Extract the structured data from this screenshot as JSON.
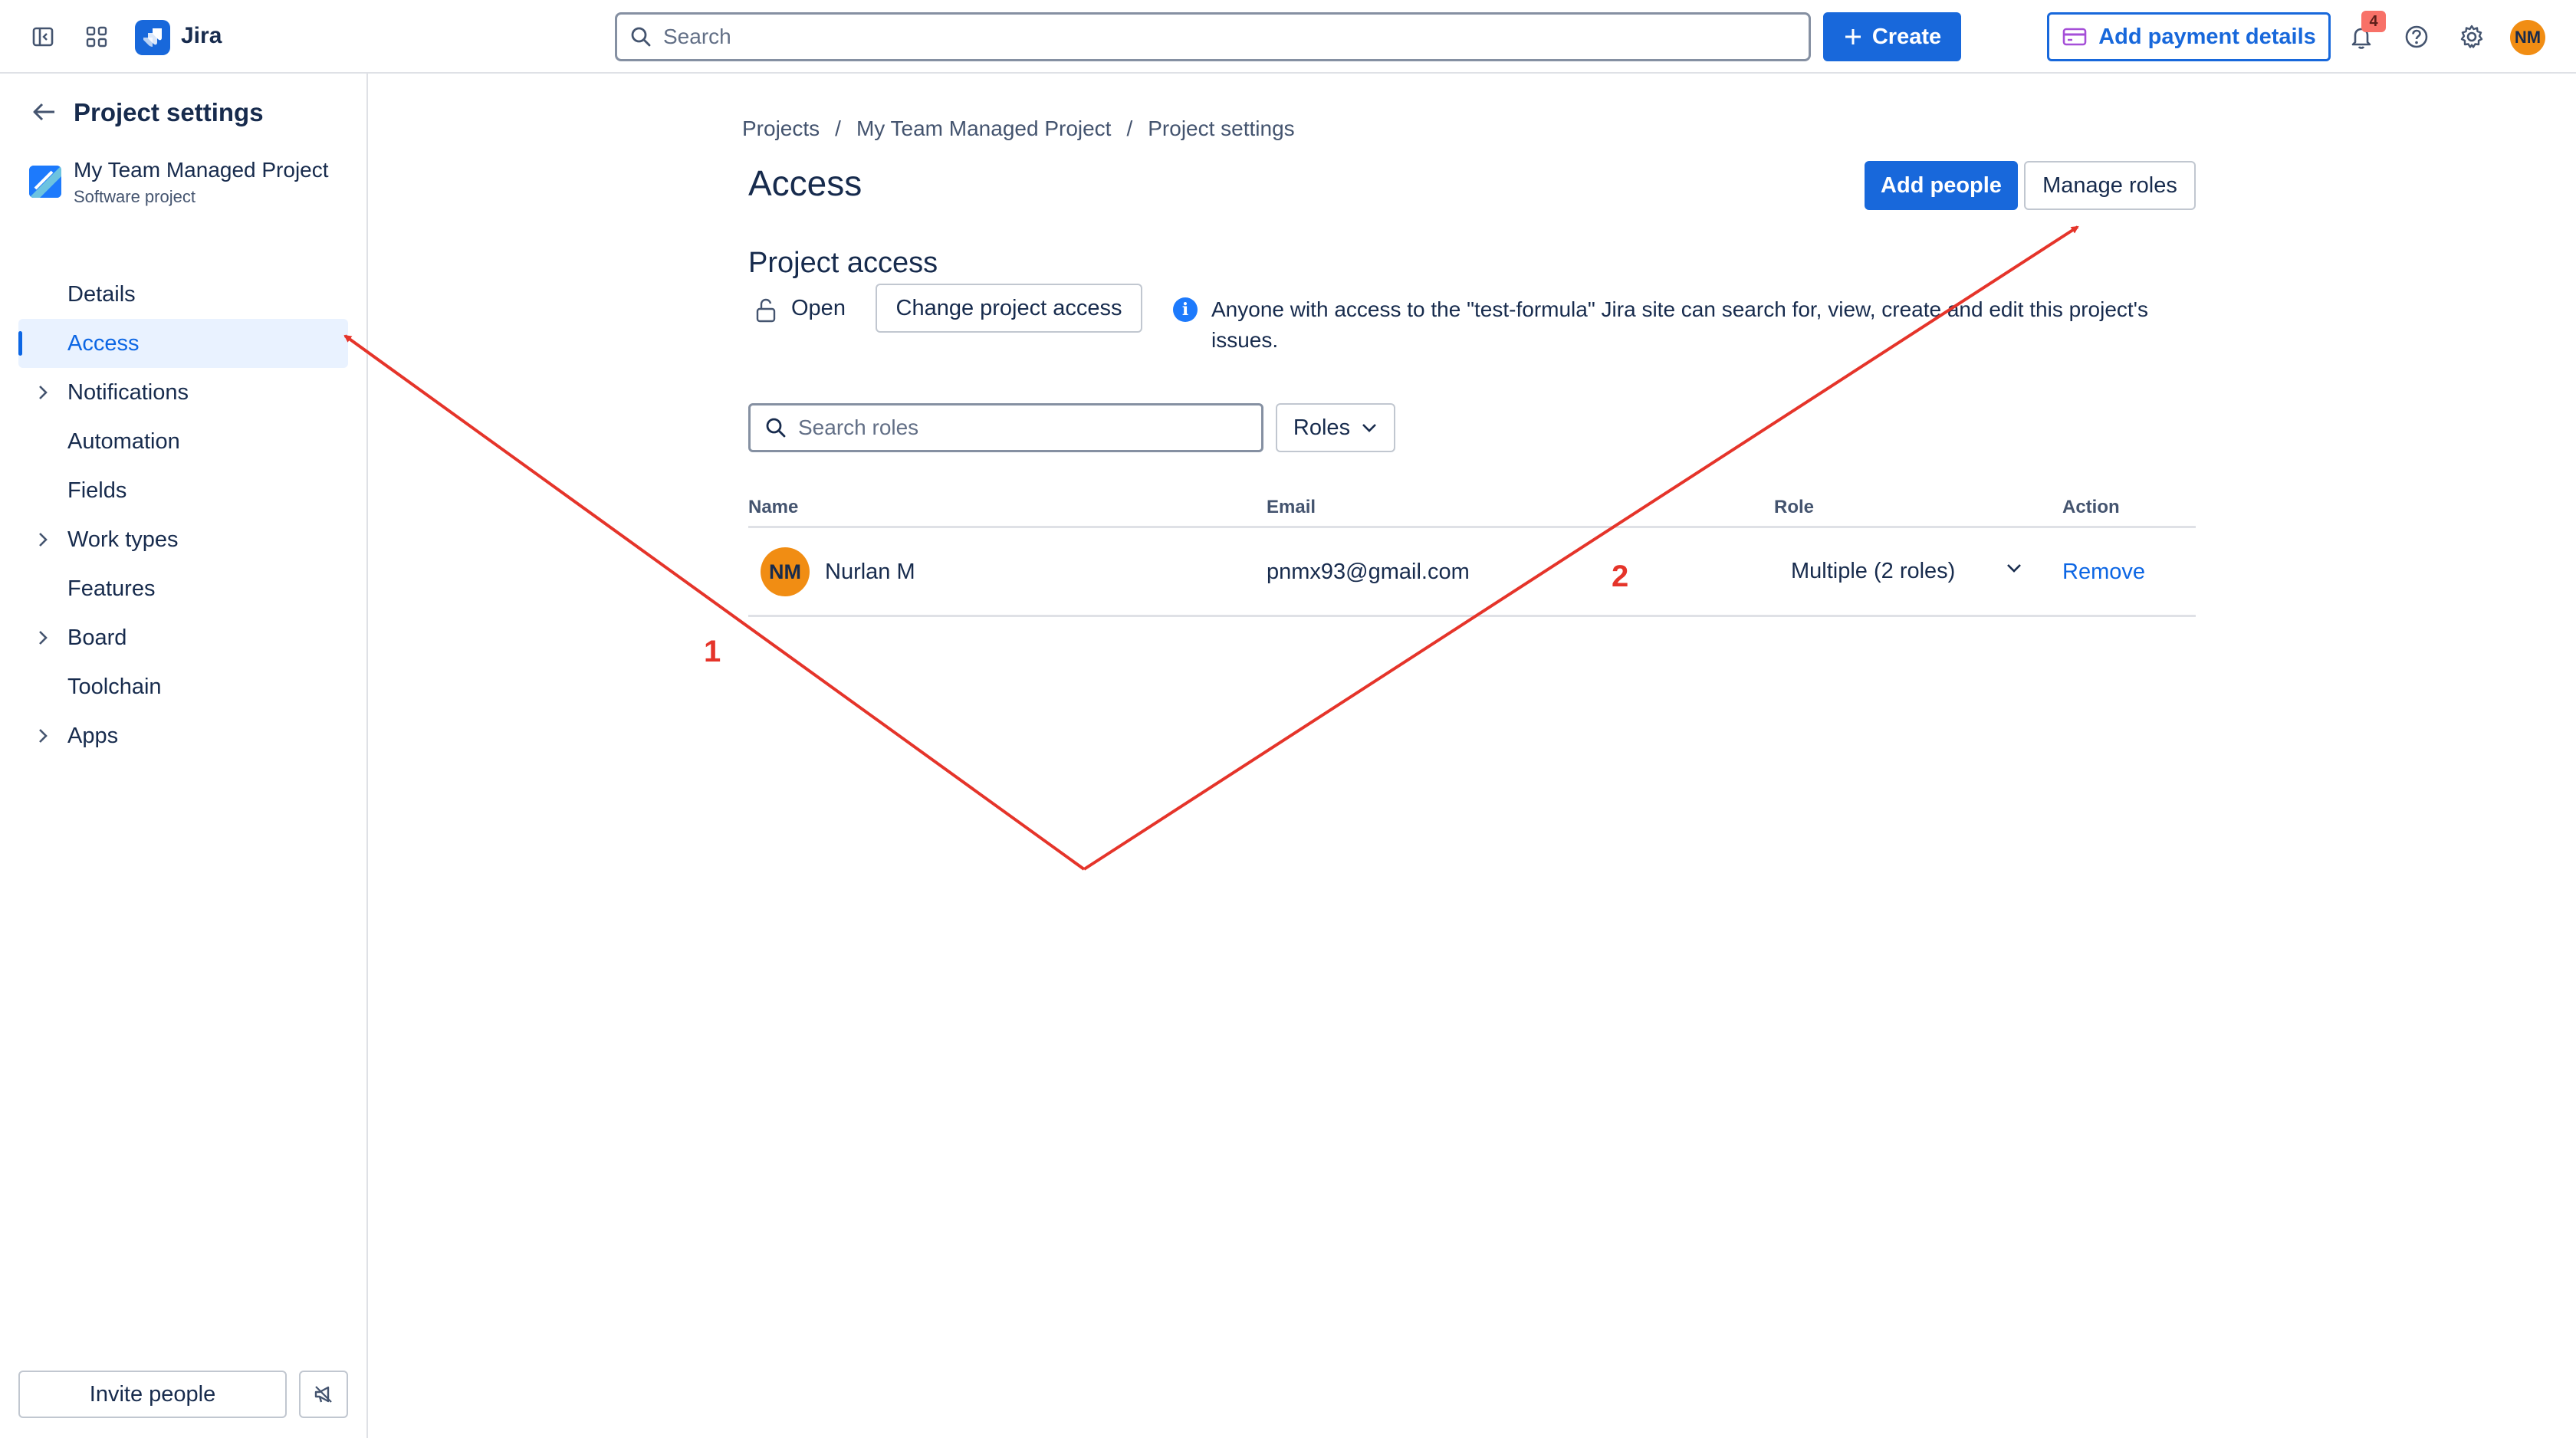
{
  "app": {
    "name": "Jira"
  },
  "topbar": {
    "search_placeholder": "Search",
    "create_label": "Create",
    "payment_label": "Add payment details",
    "notification_count": "4",
    "user_initials": "NM"
  },
  "sidebar": {
    "title": "Project settings",
    "project_name": "My Team Managed Project",
    "project_type": "Software project",
    "items": [
      {
        "label": "Details",
        "expandable": false,
        "active": false
      },
      {
        "label": "Access",
        "expandable": false,
        "active": true
      },
      {
        "label": "Notifications",
        "expandable": true,
        "active": false
      },
      {
        "label": "Automation",
        "expandable": false,
        "active": false
      },
      {
        "label": "Fields",
        "expandable": false,
        "active": false
      },
      {
        "label": "Work types",
        "expandable": true,
        "active": false
      },
      {
        "label": "Features",
        "expandable": false,
        "active": false
      },
      {
        "label": "Board",
        "expandable": true,
        "active": false
      },
      {
        "label": "Toolchain",
        "expandable": false,
        "active": false
      },
      {
        "label": "Apps",
        "expandable": true,
        "active": false
      }
    ],
    "invite_label": "Invite people"
  },
  "main": {
    "breadcrumbs": [
      "Projects",
      "My Team Managed Project",
      "Project settings"
    ],
    "title": "Access",
    "add_people_label": "Add people",
    "manage_roles_label": "Manage roles",
    "project_access": {
      "title": "Project access",
      "status": "Open",
      "change_label": "Change project access",
      "info_text": "Anyone with access to the \"test-formula\" Jira site can search for, view, create and edit this project's issues."
    },
    "roles_search_placeholder": "Search roles",
    "roles_filter_label": "Roles",
    "table": {
      "headers": {
        "name": "Name",
        "email": "Email",
        "role": "Role",
        "action": "Action"
      },
      "rows": [
        {
          "initials": "NM",
          "name": "Nurlan M",
          "email": "pnmx93@gmail.com",
          "role": "Multiple (2 roles)",
          "action": "Remove"
        }
      ]
    }
  },
  "annotations": {
    "color": "#e5342a",
    "labels": [
      "1",
      "2"
    ]
  },
  "colors": {
    "brand": "#1868db",
    "link": "#0c66e4",
    "avatar": "#f18d13"
  }
}
